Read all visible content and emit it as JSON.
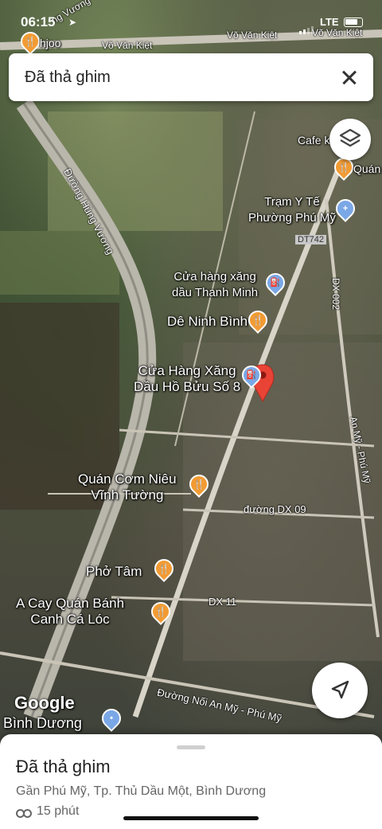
{
  "status_bar": {
    "time": "06:15",
    "network": "LTE"
  },
  "search_bar": {
    "text": "Đã thả ghim"
  },
  "map": {
    "road_labels": [
      "Võ Văn Kiệt",
      "Võ Văn Kiệt",
      "Võ Văn Kiệt",
      "Đường Hùng Vương",
      "DT742",
      "DX 002",
      "An Mỹ - Phú Mỹ",
      "đường DX 09",
      "DX 11",
      "Đường Nối An Mỹ - Phú Mỹ",
      "ng Vương"
    ],
    "places": [
      {
        "name": "hjoo"
      },
      {
        "name": "Cafe k"
      },
      {
        "name": "Quán"
      },
      {
        "line1": "Trạm Y Tế",
        "line2": "Phường Phú Mỹ"
      },
      {
        "line1": "Cửa hàng xăng",
        "line2": "dầu Thanh Minh"
      },
      {
        "name": "Dê Ninh Bình"
      },
      {
        "line1": "Cửa Hàng Xăng",
        "line2": "Dầu Hồ Bửu Số 8"
      },
      {
        "line1": "Quán Cơm Niêu",
        "line2": "Vĩnh Tường"
      },
      {
        "name": "Phở Tâm"
      },
      {
        "line1": "A Cay Quán Bánh",
        "line2": "Canh Cá Lóc"
      },
      {
        "name": "Bình Dương"
      }
    ],
    "logo": "Google"
  },
  "sheet": {
    "title": "Đã thả ghim",
    "subtitle": "Gần Phú Mỹ, Tp. Thủ Dầu Một, Bình Dương",
    "eta": "15 phút"
  },
  "colors": {
    "pin_red": "#e94335",
    "poi_orange": "#f29b34",
    "poi_blue": "#7aa7e6"
  }
}
